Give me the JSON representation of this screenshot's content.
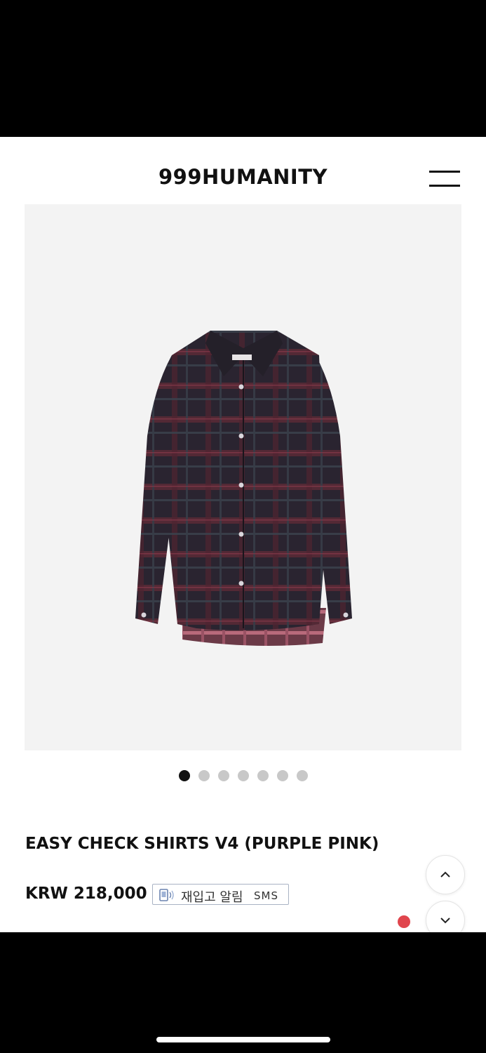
{
  "brand": {
    "logo_text": "999HUMANITY"
  },
  "icons": {
    "menu": "hamburger-menu-icon",
    "scroll_up": "chevron-up-icon",
    "scroll_down": "chevron-down-icon",
    "restock": "phone-sms-icon"
  },
  "product": {
    "title": "EASY CHECK SHIRTS V4 (PURPLE PINK)",
    "price": "KRW 218,000",
    "image_count": 7,
    "active_image_index": 0,
    "restock_button": {
      "label": "재입고 알림",
      "suffix": "SMS"
    }
  },
  "colors": {
    "notification_dot": "#e0454d",
    "active_dot": "#111111",
    "inactive_dot": "#c8c8c8"
  }
}
